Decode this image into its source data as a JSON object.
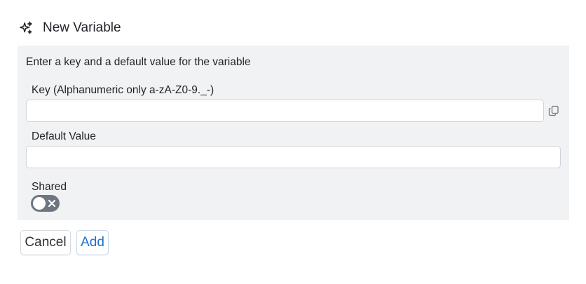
{
  "dialog": {
    "title": "New Variable",
    "icon": "sparkles-icon"
  },
  "form": {
    "description": "Enter a key and a default value for the variable",
    "key": {
      "label": "Key (Alphanumeric only a-zA-Z0-9._-)",
      "value": "",
      "placeholder": ""
    },
    "default_value": {
      "label": "Default Value",
      "value": "",
      "placeholder": ""
    },
    "shared": {
      "label": "Shared",
      "enabled": false
    },
    "copy_icon": "copy-icon"
  },
  "actions": {
    "cancel_label": "Cancel",
    "add_label": "Add"
  },
  "colors": {
    "panel_bg": "#f1f2f4",
    "accent": "#1f6fd1",
    "toggle_off": "#6e7781"
  }
}
